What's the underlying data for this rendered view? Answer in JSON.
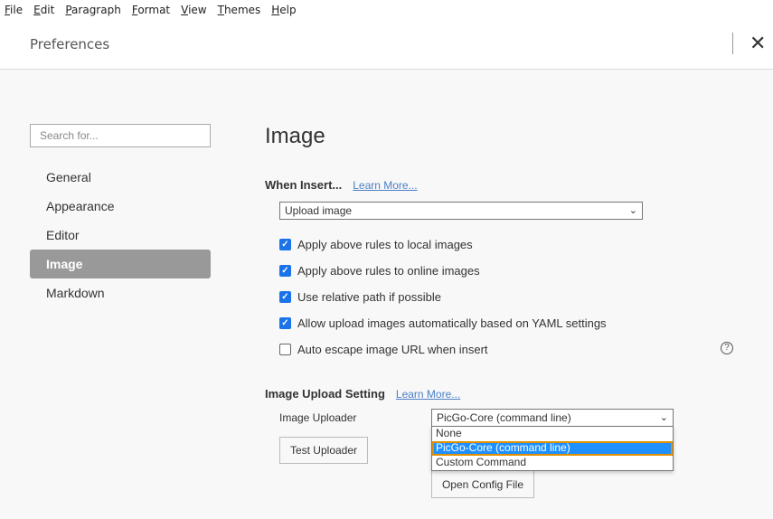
{
  "menu": [
    "File",
    "Edit",
    "Paragraph",
    "Format",
    "View",
    "Themes",
    "Help"
  ],
  "header": {
    "title": "Preferences",
    "close_icon": "close-icon"
  },
  "sidebar": {
    "search_placeholder": "Search for...",
    "items": [
      {
        "label": "General"
      },
      {
        "label": "Appearance"
      },
      {
        "label": "Editor"
      },
      {
        "label": "Image",
        "active": true
      },
      {
        "label": "Markdown"
      }
    ]
  },
  "main": {
    "title": "Image",
    "when_insert": {
      "label": "When Insert...",
      "learn_more": "Learn More...",
      "select_value": "Upload image"
    },
    "checkboxes": [
      {
        "label": "Apply above rules to local images",
        "checked": true
      },
      {
        "label": "Apply above rules to online images",
        "checked": true
      },
      {
        "label": "Use relative path if possible",
        "checked": true
      },
      {
        "label": "Allow upload images automatically based on YAML settings",
        "checked": true
      },
      {
        "label": "Auto escape image URL when insert",
        "checked": false
      }
    ],
    "help_icon": "?",
    "upload": {
      "label": "Image Upload Setting",
      "learn_more": "Learn More...",
      "uploader_label": "Image Uploader",
      "select_value": "PicGo-Core (command line)",
      "options": [
        "None",
        "PicGo-Core (command line)",
        "Custom Command"
      ],
      "highlighted": 1,
      "test_button": "Test Uploader",
      "config_button": "Open Config File"
    }
  },
  "colors": {
    "accent": "#1a73e8",
    "link": "#4a7fc7",
    "active_nav": "#999999",
    "focus": "#e09000"
  }
}
